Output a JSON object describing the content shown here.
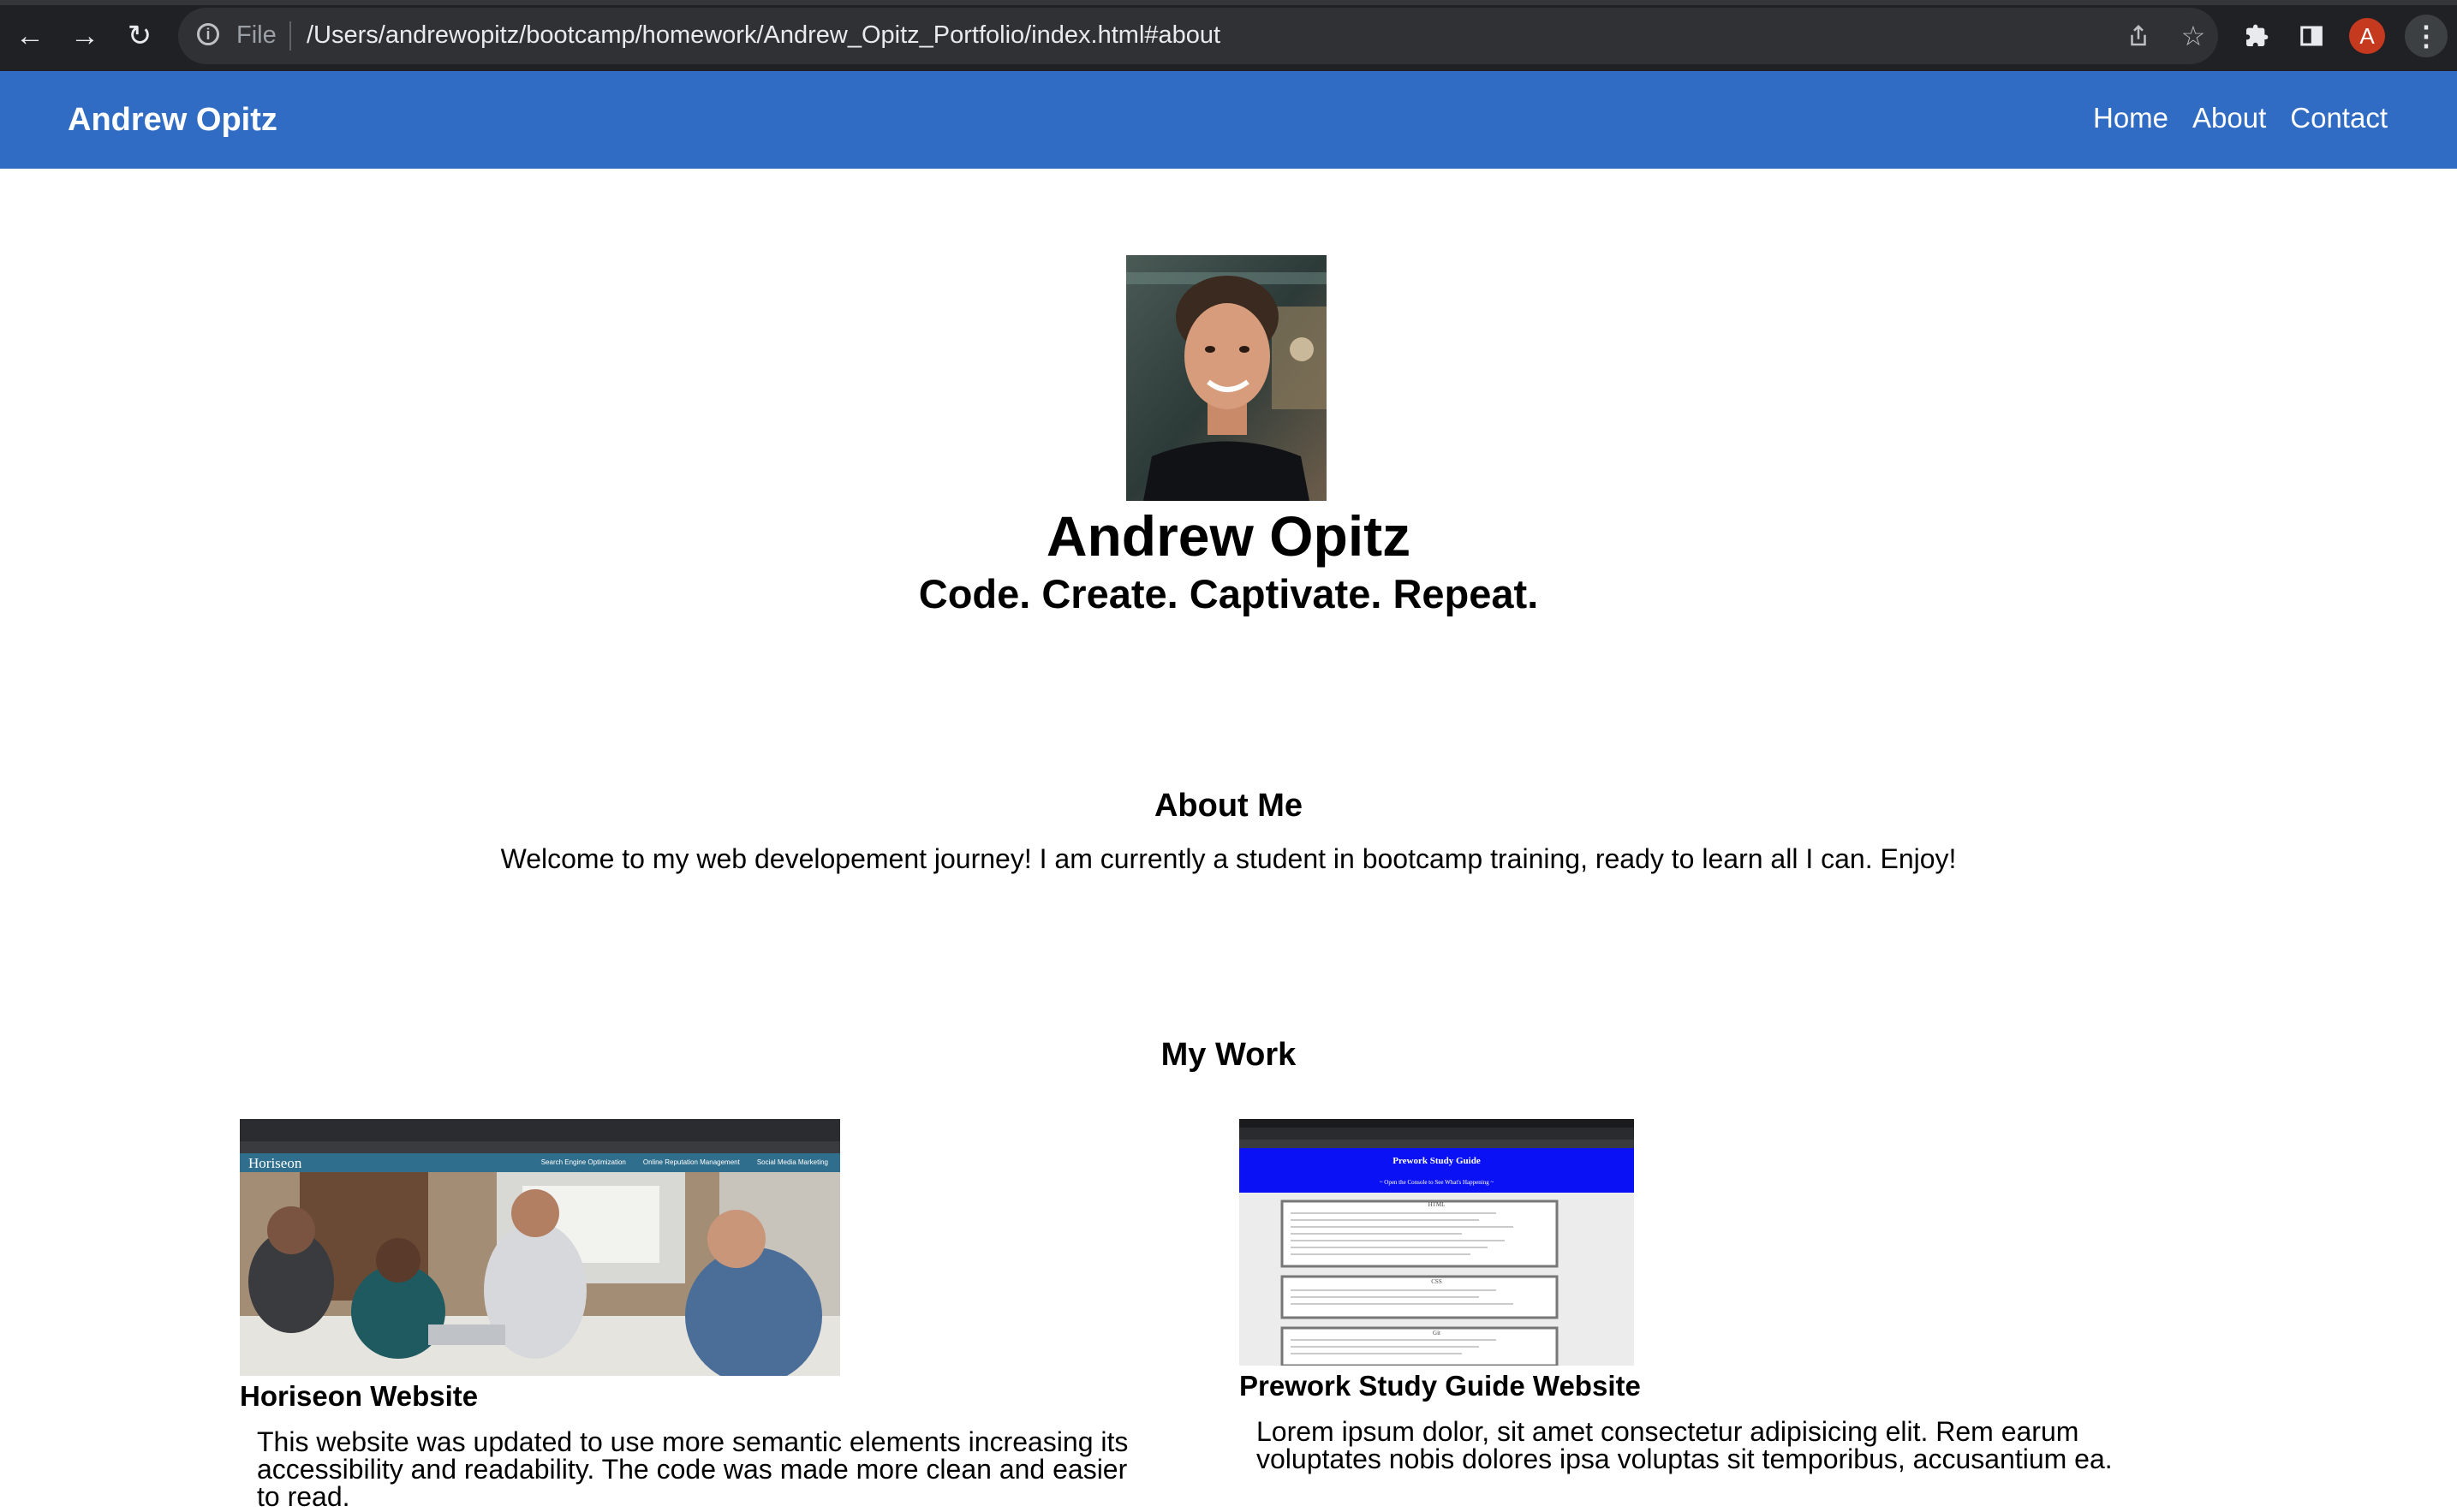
{
  "browser": {
    "file_label": "File",
    "url": "/Users/andrewopitz/bootcamp/homework/Andrew_Opitz_Portfolio/index.html#about",
    "profile_initial": "A",
    "icons": [
      "back-arrow-icon",
      "forward-arrow-icon",
      "reload-icon",
      "info-icon",
      "share-icon",
      "star-icon",
      "puzzle-icon",
      "side-panel-icon",
      "kebab-menu-icon"
    ]
  },
  "header": {
    "brand": "Andrew Opitz",
    "nav": [
      "Home",
      "About",
      "Contact"
    ],
    "color": "#306cc4"
  },
  "hero": {
    "name": "Andrew Opitz",
    "tagline": "Code. Create. Captivate. Repeat."
  },
  "about": {
    "title": "About Me",
    "text": "Welcome to my web developement journey! I am currently a student in bootcamp training, ready to learn all I can. Enjoy!"
  },
  "work": {
    "title": "My Work",
    "projects": [
      {
        "title": "Horiseon Website",
        "description": "This website was updated to use more semantic elements increasing its accessibility and readability. The code was made more clean and easier to read.",
        "thumb": {
          "site_name": "Horiseon",
          "nav": [
            "Search Engine Optimization",
            "Online Reputation Management",
            "Social Media Marketing"
          ]
        }
      },
      {
        "title": "Prework Study Guide Website",
        "description": "Lorem ipsum dolor, sit amet consectetur adipisicing elit. Rem earum voluptates nobis dolores ipsa voluptas sit temporibus, accusantium ea.",
        "thumb": {
          "heading": "Prework Study Guide",
          "subheading": "~ Open the Console to See What's Happening ~",
          "sections": [
            "HTML",
            "CSS",
            "Git"
          ]
        }
      }
    ]
  }
}
